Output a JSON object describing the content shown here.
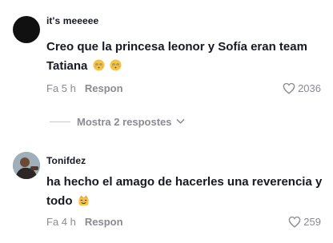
{
  "comments": [
    {
      "username": "it's meeeee",
      "text_line1": "Creo que la princesa leonor y Sofía eran team",
      "text_line2": "Tatiana",
      "emoji": "woozy-face-emoji",
      "time": "Fa 5 h",
      "reply_label": "Respon",
      "likes": "2036"
    },
    {
      "username": "Tonifdez",
      "text_line1": "ha hecho el amago de hacerles una reverencia y",
      "text_line2": "todo",
      "emoji": "crown-face-emoji",
      "time": "Fa 4 h",
      "reply_label": "Respon",
      "likes": "259"
    }
  ],
  "replies_toggle": {
    "label": "Mostra 2 respostes"
  },
  "colors": {
    "text": "#161823",
    "muted": "#8a8b91",
    "background": "#ffffff"
  }
}
